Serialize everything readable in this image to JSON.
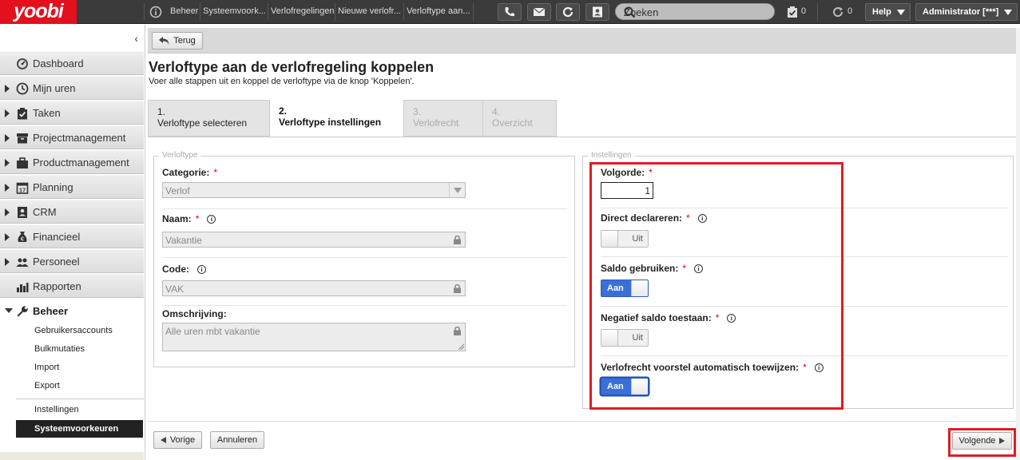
{
  "app": {
    "logo": "yoobi"
  },
  "breadcrumbs": [
    "Beheer",
    "Systeemvoork...",
    "Verlofregelingen",
    "Nieuwe verlofr...",
    "Verloftype aan..."
  ],
  "topbar": {
    "search_placeholder": "Zoeken",
    "tasks_count": "0",
    "sync_count": "0",
    "help_label": "Help",
    "user_label": "Administrator [***]"
  },
  "sidebar": {
    "collapse_glyph": "‹",
    "items": [
      {
        "label": "Dashboard",
        "icon": "dashboard-icon",
        "expandable": false
      },
      {
        "label": "Mijn uren",
        "icon": "clock-icon",
        "expandable": true
      },
      {
        "label": "Taken",
        "icon": "clipboard-icon",
        "expandable": true
      },
      {
        "label": "Projectmanagement",
        "icon": "project-box-icon",
        "expandable": true
      },
      {
        "label": "Productmanagement",
        "icon": "briefcase-icon",
        "expandable": true
      },
      {
        "label": "Planning",
        "icon": "calendar-icon",
        "expandable": true
      },
      {
        "label": "CRM",
        "icon": "contact-card-icon",
        "expandable": true
      },
      {
        "label": "Financieel",
        "icon": "money-bag-icon",
        "expandable": true
      },
      {
        "label": "Personeel",
        "icon": "people-icon",
        "expandable": true
      },
      {
        "label": "Rapporten",
        "icon": "bar-chart-icon",
        "expandable": false
      }
    ],
    "beheer": {
      "label": "Beheer",
      "icon": "wrench-icon",
      "subitems": [
        "Gebruikersaccounts",
        "Bulkmutaties",
        "Import",
        "Export"
      ],
      "subitems2": [
        "Instellingen"
      ],
      "active": "Systeemvoorkeuren"
    }
  },
  "toolbar": {
    "back_label": "Terug"
  },
  "page": {
    "title": "Verloftype aan de verlofregeling koppelen",
    "subtitle": "Voer alle stappen uit en koppel de verloftype via de knop 'Koppelen'."
  },
  "steps": [
    {
      "num": "1.",
      "label": "Verloftype selecteren",
      "state": "done"
    },
    {
      "num": "2.",
      "label": "Verloftype instellingen",
      "state": "active"
    },
    {
      "num": "3.",
      "label": "Verlofrecht",
      "state": "disabled"
    },
    {
      "num": "4.",
      "label": "Overzicht",
      "state": "disabled"
    }
  ],
  "verloftype": {
    "legend": "Verloftype",
    "categorie_label": "Categorie:",
    "categorie_value": "Verlof",
    "naam_label": "Naam:",
    "naam_value": "Vakantie",
    "code_label": "Code:",
    "code_value": "VAK",
    "omschrijving_label": "Omschrijving:",
    "omschrijving_value": "Alle uren mbt vakantie"
  },
  "instellingen": {
    "legend": "Instellingen",
    "volgorde_label": "Volgorde:",
    "volgorde_value": "1",
    "direct_label": "Direct declareren:",
    "direct_value": "Uit",
    "saldo_label": "Saldo gebruiken:",
    "saldo_value": "Aan",
    "negatief_label": "Negatief saldo toestaan:",
    "negatief_value": "Uit",
    "verlofrecht_label": "Verlofrecht voorstel automatisch toewijzen:",
    "verlofrecht_value": "Aan"
  },
  "footer": {
    "vorige_label": "Vorige",
    "annuleren_label": "Annuleren",
    "volgende_label": "Volgende"
  },
  "colors": {
    "brand": "#e3101d",
    "toggle_on": "#3a6fd6",
    "highlight": "#e01c24"
  }
}
